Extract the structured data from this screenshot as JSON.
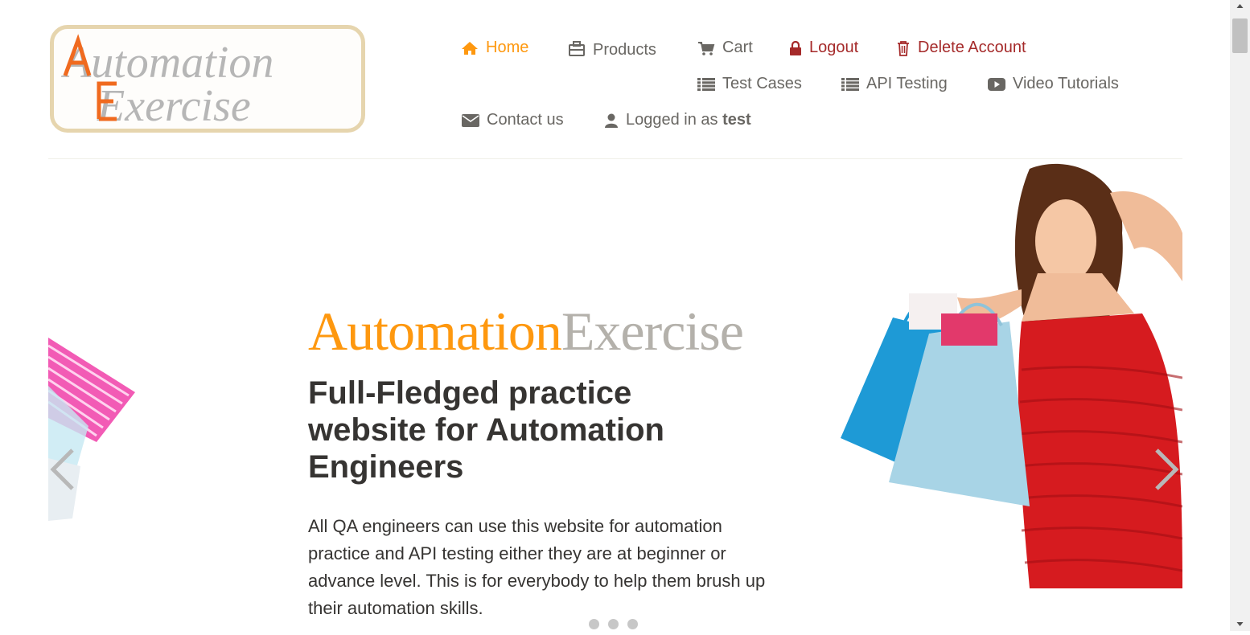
{
  "logo": {
    "line1": "Automation",
    "line2": "Exercise"
  },
  "nav": {
    "home": "Home",
    "products": "Products",
    "cart": "Cart",
    "logout": "Logout",
    "delete_account": "Delete Account",
    "test_cases": "Test Cases",
    "api_testing": "API Testing",
    "video_tutorials": "Video Tutorials",
    "contact_us": "Contact us",
    "logged_in_prefix": "Logged in as",
    "username": "test"
  },
  "slider": {
    "brand_part1": "Automation",
    "brand_part2": "Exercise",
    "headline": "Full-Fledged practice website for Automation Engineers",
    "description": "All QA engineers can use this website for automation practice and API testing either they are at beginner or advance level. This is for everybody to help them brush up their automation skills.",
    "active_slide": 1,
    "slide_count": 3
  },
  "colors": {
    "accent": "#fe980f",
    "danger": "#a52a2a",
    "text": "#696763",
    "heading": "#363432",
    "brand_gray": "#b4b1ab"
  },
  "icons": {
    "home": "home-icon",
    "products": "briefcase-icon",
    "cart": "cart-icon",
    "logout": "lock-icon",
    "delete": "trash-icon",
    "test_cases": "list-icon",
    "api_testing": "list-icon",
    "video": "youtube-play-icon",
    "contact": "envelope-icon",
    "user": "user-icon"
  }
}
